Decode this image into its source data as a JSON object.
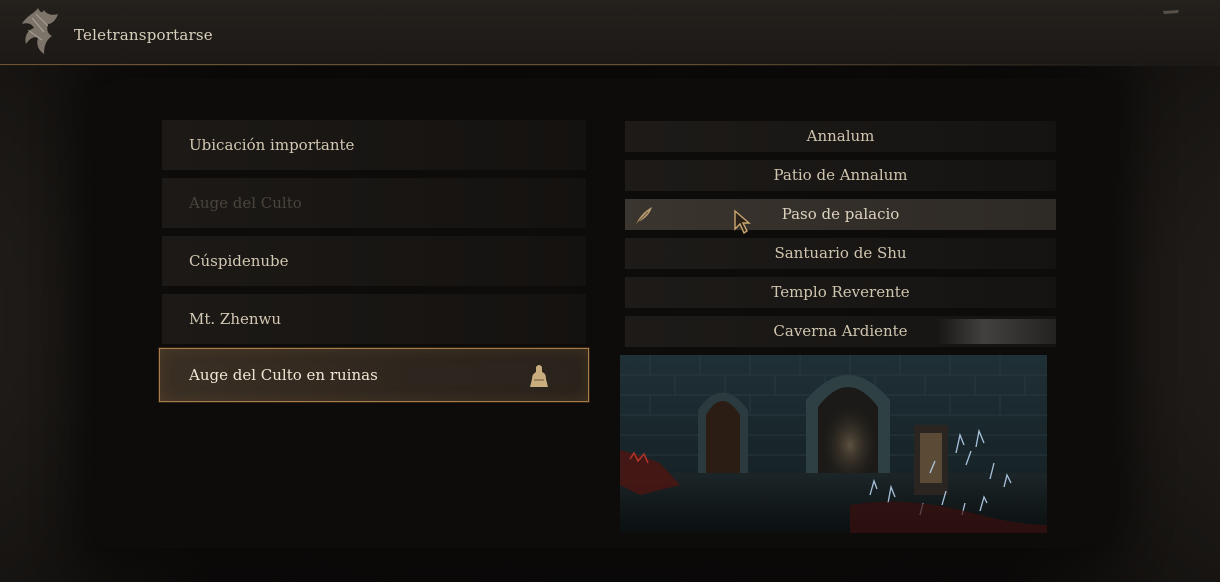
{
  "header": {
    "title": "Teletransportarse"
  },
  "regions": [
    {
      "label": "Ubicación importante",
      "state": "normal"
    },
    {
      "label": "Auge del Culto",
      "state": "disabled"
    },
    {
      "label": "Cúspidenube",
      "state": "normal"
    },
    {
      "label": "Mt. Zhenwu",
      "state": "normal"
    },
    {
      "label": "Auge del Culto en ruinas",
      "state": "selected",
      "icon": "shrine-icon"
    }
  ],
  "places": [
    {
      "label": "Annalum"
    },
    {
      "label": "Patio de Annalum"
    },
    {
      "label": "Paso de palacio",
      "selected": true,
      "icon": "feather-icon"
    },
    {
      "label": "Santuario de Shu"
    },
    {
      "label": "Templo Reverente"
    },
    {
      "label": "Caverna Ardiente"
    }
  ],
  "colors": {
    "accent_border": "#a57e4c",
    "text": "#d2c7b2",
    "disabled_text": "#4a433b",
    "background": "#151210"
  }
}
